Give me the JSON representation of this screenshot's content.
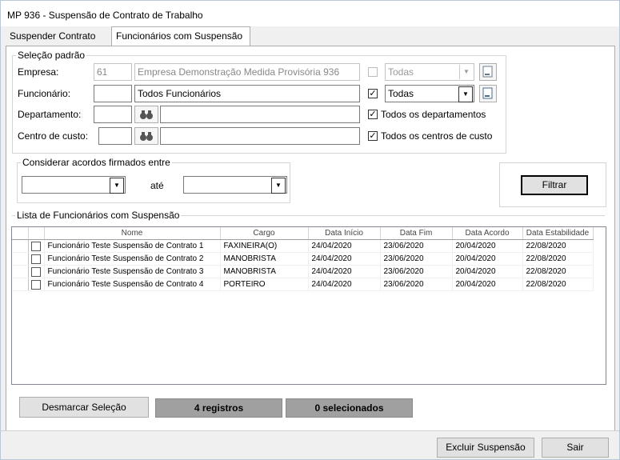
{
  "window": {
    "title": "MP 936 - Suspensão de Contrato de Trabalho"
  },
  "tabs": [
    {
      "label": "Suspender Contrato"
    },
    {
      "label": "Funcionários com Suspensão"
    }
  ],
  "selecao": {
    "legend": "Seleção padrão",
    "empresa": {
      "label": "Empresa:",
      "code": "61",
      "name": "Empresa Demonstração Medida Provisória 936",
      "all_label": "Todas",
      "all_checked": false
    },
    "funcionario": {
      "label": "Funcionário:",
      "code": "",
      "name": "Todos Funcionários",
      "all_label": "Todas",
      "all_checked": true
    },
    "departamento": {
      "label": "Departamento:",
      "code": "",
      "name": "",
      "all_label": "Todos os departamentos",
      "all_checked": true
    },
    "centro_custo": {
      "label": "Centro de custo:",
      "code": "",
      "name": "",
      "all_label": "Todos os centros de custo",
      "all_checked": true
    }
  },
  "acordos": {
    "legend": "Considerar acordos firmados entre",
    "from": "",
    "between_label": "até",
    "to": ""
  },
  "filter_button": "Filtrar",
  "list": {
    "legend": "Lista de Funcionários com Suspensão",
    "columns": [
      "Nome",
      "Cargo",
      "Data Início",
      "Data Fim",
      "Data Acordo",
      "Data Estabilidade"
    ],
    "rows": [
      {
        "nome": "Funcionário Teste Suspensão de Contrato 1",
        "cargo": "FAXINEIRA(O)",
        "inicio": "24/04/2020",
        "fim": "23/06/2020",
        "acordo": "20/04/2020",
        "estabilidade": "22/08/2020"
      },
      {
        "nome": "Funcionário Teste Suspensão de Contrato 2",
        "cargo": "MANOBRISTA",
        "inicio": "24/04/2020",
        "fim": "23/06/2020",
        "acordo": "20/04/2020",
        "estabilidade": "22/08/2020"
      },
      {
        "nome": "Funcionário Teste Suspensão de Contrato 3",
        "cargo": "MANOBRISTA",
        "inicio": "24/04/2020",
        "fim": "23/06/2020",
        "acordo": "20/04/2020",
        "estabilidade": "22/08/2020"
      },
      {
        "nome": "Funcionário Teste Suspensão de Contrato 4",
        "cargo": "PORTEIRO",
        "inicio": "24/04/2020",
        "fim": "23/06/2020",
        "acordo": "20/04/2020",
        "estabilidade": "22/08/2020"
      }
    ]
  },
  "status": {
    "desmarcar": "Desmarcar Seleção",
    "registros": "4 registros",
    "selecionados": "0 selecionados"
  },
  "footer": {
    "excluir": "Excluir Suspensão",
    "sair": "Sair"
  },
  "icons": {
    "binoculars": "binoculars-icon",
    "lookup": "lookup-icon",
    "dropdown": "chevron-down-icon"
  }
}
